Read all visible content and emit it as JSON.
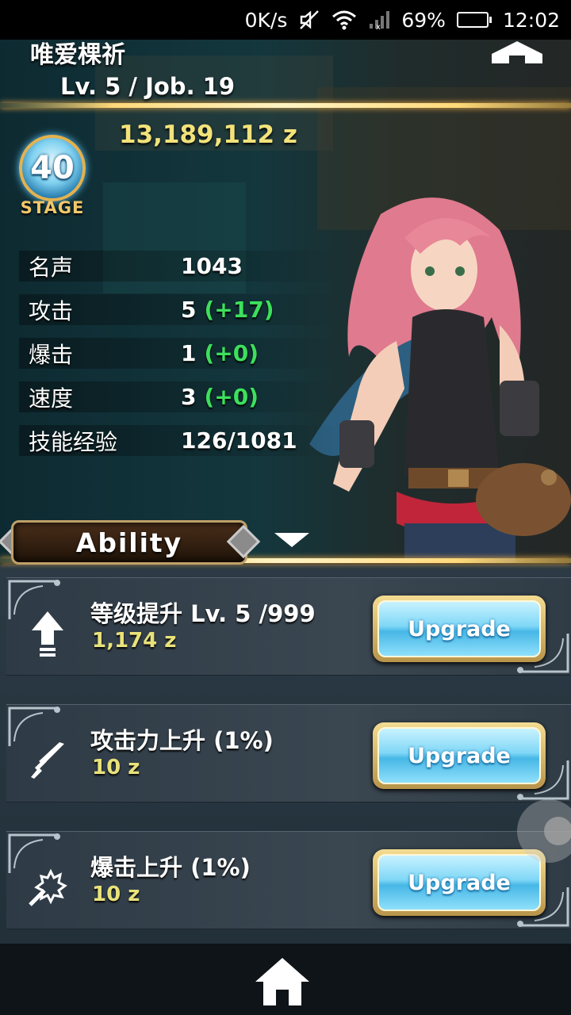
{
  "status_bar": {
    "net_speed": "0K/s",
    "battery": "69%",
    "battery_level": 0.69,
    "time": "12:02"
  },
  "player": {
    "name": "唯爱棵祈",
    "level_line": "Lv. 5 / Job. 19",
    "money": "13,189,112 z"
  },
  "stage": {
    "number": "40",
    "label": "STAGE"
  },
  "stats": [
    {
      "label": "名声",
      "value": "1043",
      "bonus": ""
    },
    {
      "label": "攻击",
      "value": "5",
      "bonus": "(+17)"
    },
    {
      "label": "爆击",
      "value": "1",
      "bonus": "(+0)"
    },
    {
      "label": "速度",
      "value": "3",
      "bonus": "(+0)"
    },
    {
      "label": "技能经验",
      "value": "126/1081",
      "bonus": ""
    }
  ],
  "tab": {
    "label": "Ability"
  },
  "abilities": [
    {
      "title": "等级提升 Lv. 5 /999",
      "cost": "1,174 z",
      "button": "Upgrade",
      "icon": "up-arrow-icon"
    },
    {
      "title": "攻击力上升 (1%)",
      "cost": "10 z",
      "button": "Upgrade",
      "icon": "sword-icon"
    },
    {
      "title": "爆击上升 (1%)",
      "cost": "10 z",
      "button": "Upgrade",
      "icon": "critical-icon"
    }
  ],
  "colors": {
    "gold_text": "#f2e27a",
    "bonus_green": "#3de05c",
    "button_blue": "#7fd7f6"
  }
}
